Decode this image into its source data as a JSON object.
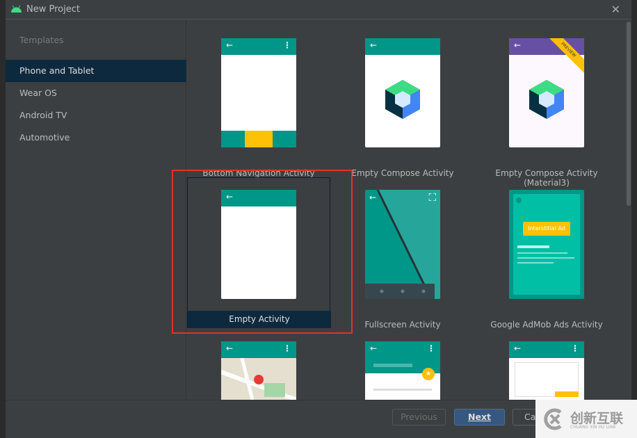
{
  "window": {
    "title": "New Project",
    "close_icon": "close-icon"
  },
  "sidebar": {
    "header": "Templates",
    "items": [
      {
        "label": "Phone and Tablet",
        "selected": true
      },
      {
        "label": "Wear OS"
      },
      {
        "label": "Android TV"
      },
      {
        "label": "Automotive"
      }
    ]
  },
  "templates": [
    {
      "label": "Bottom Navigation Activity"
    },
    {
      "label": "Empty Compose Activity"
    },
    {
      "label": "Empty Compose Activity (Material3)",
      "badge": "PREVIEW"
    },
    {
      "label": "Empty Activity",
      "selected": true
    },
    {
      "label": "Fullscreen Activity"
    },
    {
      "label": "Google AdMob Ads Activity",
      "ad_label": "Interstitial Ad"
    },
    {
      "label": ""
    },
    {
      "label": ""
    },
    {
      "label": ""
    }
  ],
  "footer": {
    "previous": "Previous",
    "next": "Next",
    "cancel": "Ca"
  },
  "watermark": {
    "text": "创新互联",
    "sub": "CHUANG XIN HU LIAN"
  },
  "colors": {
    "accent": "#009688",
    "selection": "#0d293e",
    "highlight": "#e0332a",
    "primary_button": "#365880"
  }
}
